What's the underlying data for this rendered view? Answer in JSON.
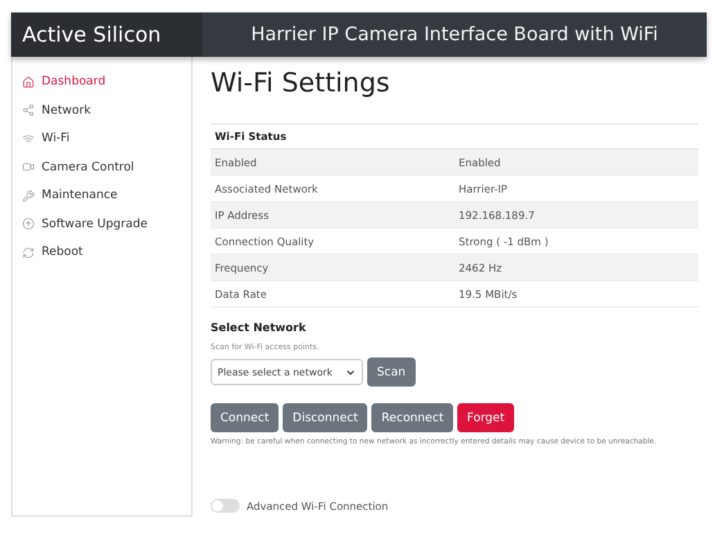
{
  "header": {
    "brand": "Active Silicon",
    "title": "Harrier IP Camera Interface Board with WiFi"
  },
  "sidebar": {
    "items": [
      {
        "label": "Dashboard",
        "selected": true
      },
      {
        "label": "Network",
        "selected": false
      },
      {
        "label": "Wi-Fi",
        "selected": false
      },
      {
        "label": "Camera Control",
        "selected": false
      },
      {
        "label": "Maintenance",
        "selected": false
      },
      {
        "label": "Software Upgrade",
        "selected": false
      },
      {
        "label": "Reboot",
        "selected": false
      }
    ]
  },
  "page_title": "Wi-Fi Settings",
  "status_table": {
    "heading": "Wi-Fi Status",
    "rows": [
      {
        "label": "Enabled",
        "value": "Enabled"
      },
      {
        "label": "Associated Network",
        "value": "Harrier-IP"
      },
      {
        "label": "IP Address",
        "value": "192.168.189.7"
      },
      {
        "label": "Connection Quality",
        "value": "Strong ( -1 dBm )"
      },
      {
        "label": "Frequency",
        "value": "2462 Hz"
      },
      {
        "label": "Data Rate",
        "value": "19.5 MBit/s"
      }
    ]
  },
  "select_network": {
    "heading": "Select Network",
    "hint": "Scan for Wi-Fi access points.",
    "dropdown": "Please select a network",
    "scan_button": "Scan"
  },
  "actions": [
    {
      "label": "Connect",
      "kind": "secondary"
    },
    {
      "label": "Disconnect",
      "kind": "secondary"
    },
    {
      "label": "Reconnect",
      "kind": "secondary"
    },
    {
      "label": "Forget",
      "kind": "danger"
    }
  ],
  "warning": "Warning: be careful when connecting to new network as incorrectly entered details may cause device to be unreachable.",
  "advanced_toggle": {
    "label": "Advanced Wi-Fi Connection",
    "on": false
  }
}
